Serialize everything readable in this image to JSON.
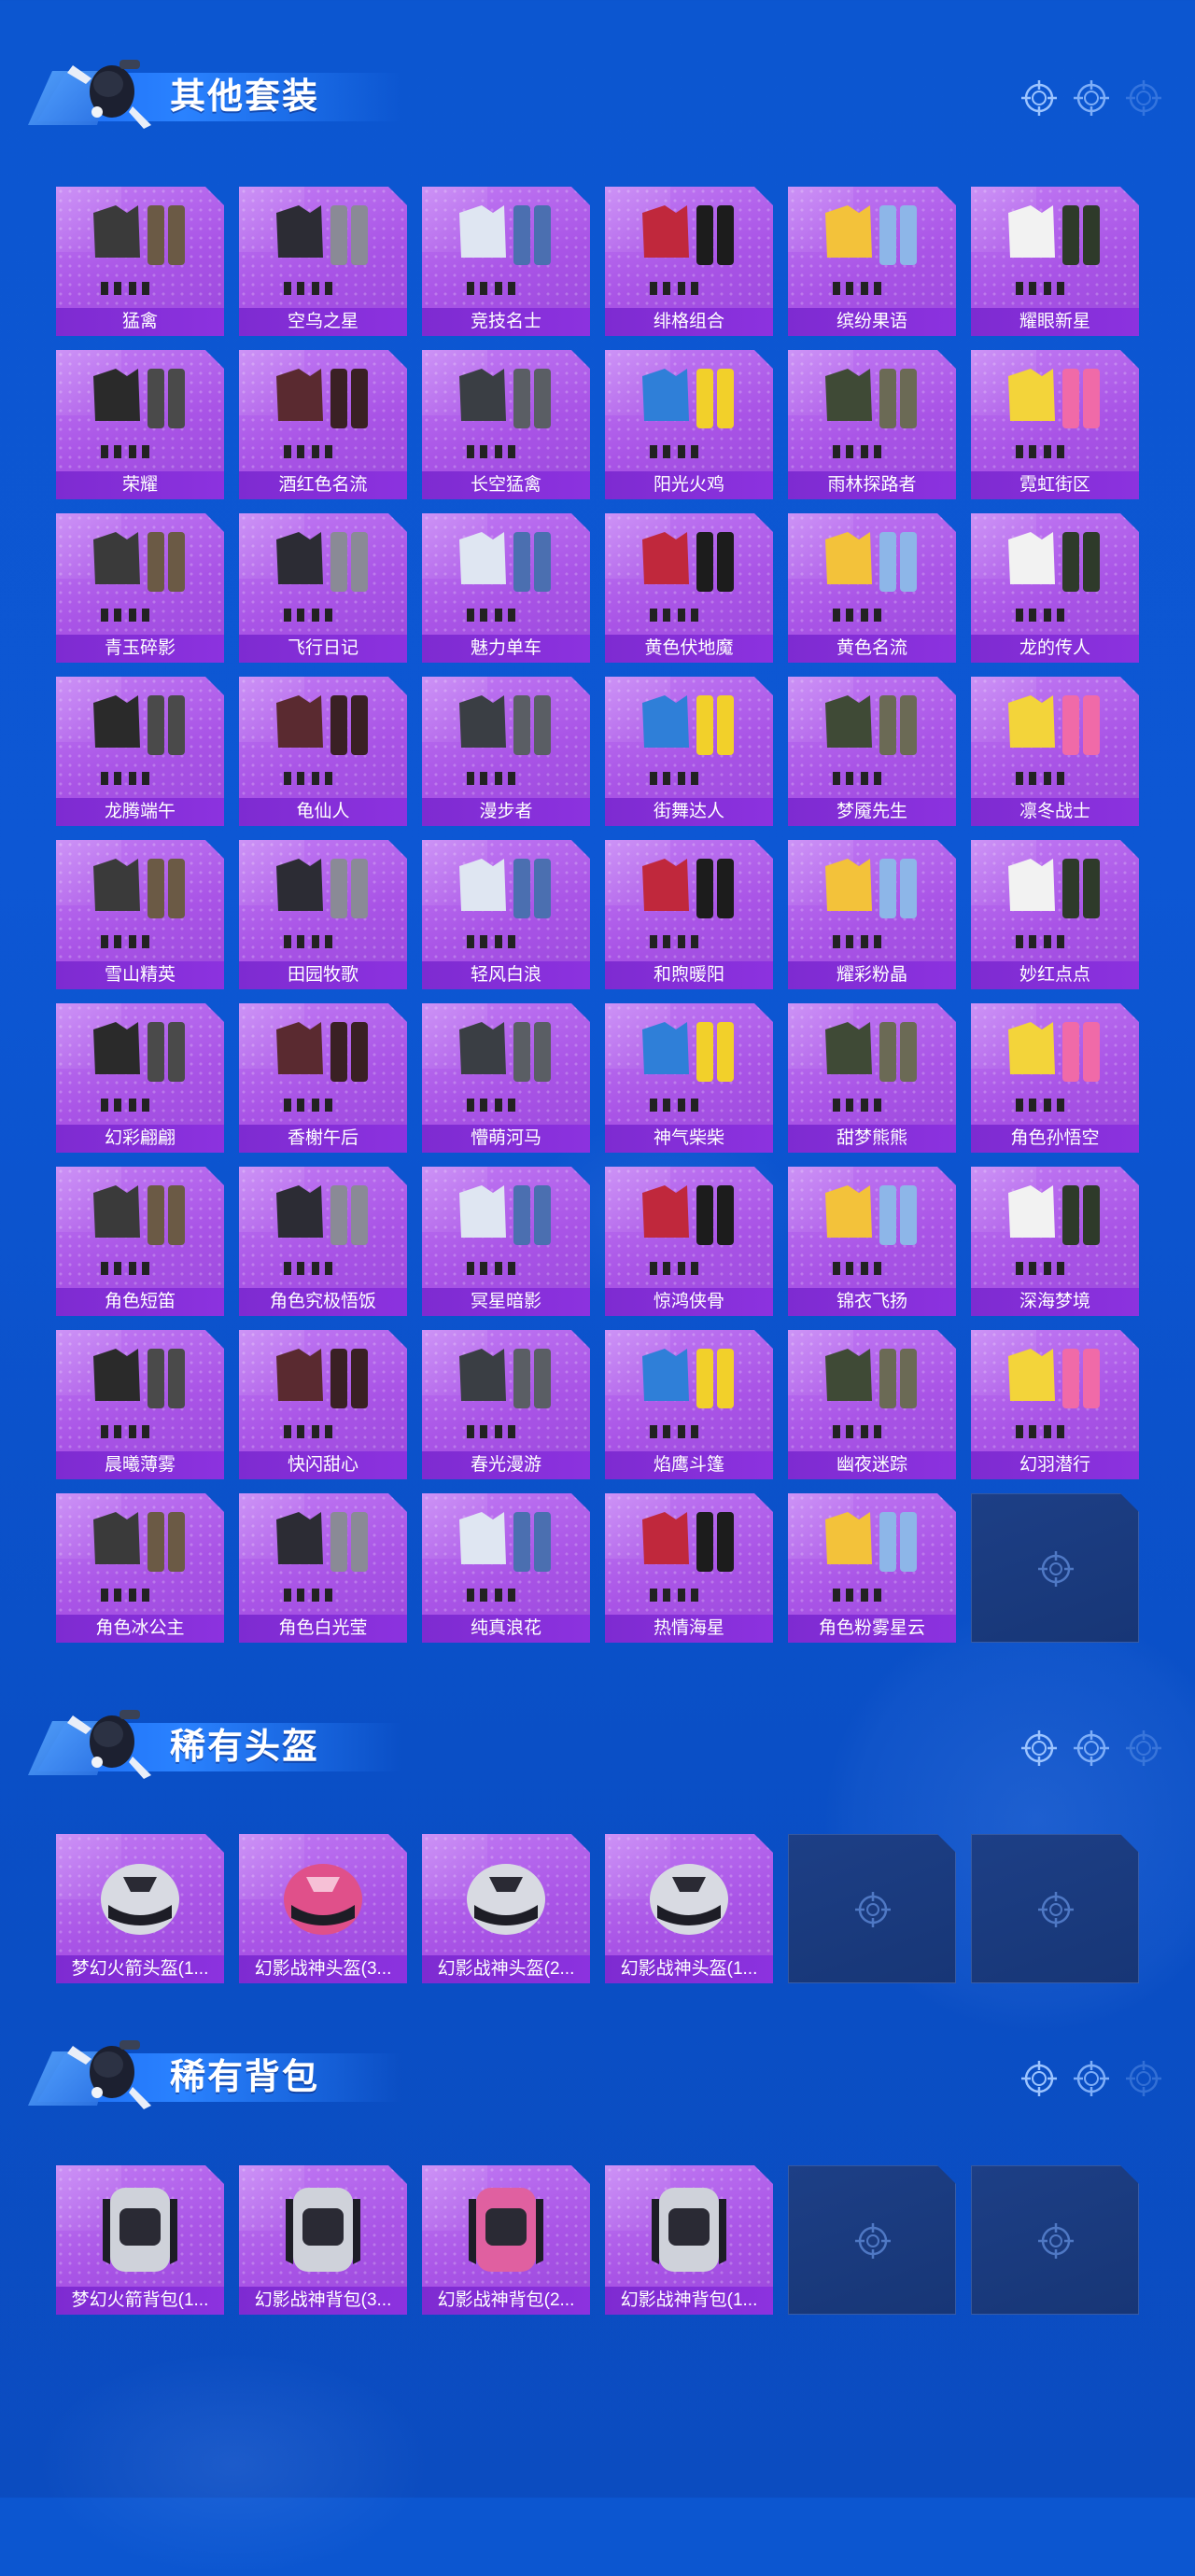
{
  "sections": [
    {
      "title": "其他套装",
      "items": [
        "猛禽",
        "空乌之星",
        "竞技名士",
        "绯格组合",
        "缤纷果语",
        "耀眼新星",
        "荣耀",
        "酒红色名流",
        "长空猛禽",
        "阳光火鸡",
        "雨林探路者",
        "霓虹街区",
        "青玉碎影",
        "飞行日记",
        "魅力单车",
        "黄色伏地魔",
        "黄色名流",
        "龙的传人",
        "龙腾端午",
        "龟仙人",
        "漫步者",
        "街舞达人",
        "梦魇先生",
        "凛冬战士",
        "雪山精英",
        "田园牧歌",
        "轻风白浪",
        "和煦暖阳",
        "耀彩粉晶",
        "妙红点点",
        "幻彩翩翩",
        "香榭午后",
        "懵萌河马",
        "神气柴柴",
        "甜梦熊熊",
        "角色孙悟空",
        "角色短笛",
        "角色究极悟饭",
        "冥星暗影",
        "惊鸿侠骨",
        "锦衣飞扬",
        "深海梦境",
        "晨曦薄雾",
        "快闪甜心",
        "春光漫游",
        "焰鹰斗篷",
        "幽夜迷踪",
        "幻羽潜行",
        "角色冰公主",
        "角色白光莹",
        "纯真浪花",
        "热情海星",
        "角色粉雾星云"
      ],
      "empty_slots": 1
    },
    {
      "title": "稀有头盔",
      "items": [
        "梦幻火箭头盔(1...",
        "幻影战神头盔(3...",
        "幻影战神头盔(2...",
        "幻影战神头盔(1..."
      ],
      "empty_slots": 2
    },
    {
      "title": "稀有背包",
      "items": [
        "梦幻火箭背包(1...",
        "幻影战神背包(3...",
        "幻影战神背包(2...",
        "幻影战神背包(1..."
      ],
      "empty_slots": 2
    }
  ],
  "colors": {
    "card_purple": "#a954e6",
    "label_purple": "#7e2bd1",
    "page_blue": "#0c56d0",
    "empty_slot": "#1d3f86"
  },
  "icons": {
    "mascot": "mascot-icon",
    "crosshair": "crosshair-icon",
    "empty": "empty-slot-crosshair-icon"
  }
}
